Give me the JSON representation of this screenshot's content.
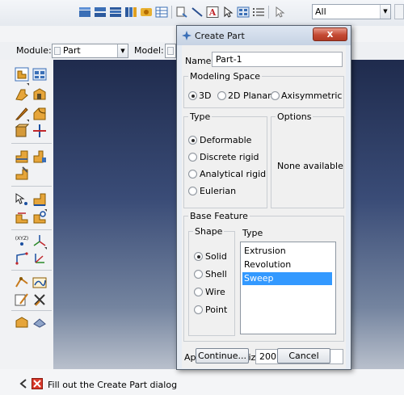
{
  "toolbar": {
    "filter_value": "All",
    "icons": [
      "view-cube-icon",
      "view-front-icon",
      "view-top-icon",
      "view-side-icon",
      "render-style-icon",
      "table-icon",
      "query-icon",
      "line-tool-icon",
      "text-annotation-icon",
      "select-cursor-icon",
      "grid-table-icon",
      "list-options-icon",
      "selection-arrow-icon"
    ]
  },
  "context": {
    "module_label": "Module:",
    "module_value": "Part",
    "model_label": "Model:"
  },
  "dialog": {
    "title": "Create Part",
    "close_glyph": "x",
    "name_label": "Name:",
    "name_value": "Part-1",
    "modeling_space": {
      "label": "Modeling Space",
      "options": [
        {
          "label": "3D",
          "checked": true
        },
        {
          "label": "2D Planar",
          "checked": false
        },
        {
          "label": "Axisymmetric",
          "checked": false
        }
      ]
    },
    "type": {
      "label": "Type",
      "options": [
        {
          "label": "Deformable",
          "checked": true
        },
        {
          "label": "Discrete rigid",
          "checked": false
        },
        {
          "label": "Analytical rigid",
          "checked": false
        },
        {
          "label": "Eulerian",
          "checked": false
        }
      ]
    },
    "options": {
      "label": "Options",
      "text": "None available"
    },
    "base_feature": {
      "label": "Base Feature",
      "shape": {
        "label": "Shape",
        "options": [
          {
            "label": "Solid",
            "checked": true
          },
          {
            "label": "Shell",
            "checked": false
          },
          {
            "label": "Wire",
            "checked": false
          },
          {
            "label": "Point",
            "checked": false
          }
        ]
      },
      "type": {
        "label": "Type",
        "items": [
          {
            "label": "Extrusion",
            "selected": false
          },
          {
            "label": "Revolution",
            "selected": false
          },
          {
            "label": "Sweep",
            "selected": true
          }
        ]
      }
    },
    "approx_size_label": "Approximate size:",
    "approx_size_value": "200",
    "continue_label": "Continue...",
    "cancel_label": "Cancel"
  },
  "status": {
    "message": "Fill out the Create Part dialog"
  },
  "colors": {
    "selection": "#3399ff",
    "close_button": "#c44a33",
    "viewport_top": "#1f2b4d",
    "viewport_bottom": "#b9c0cc"
  }
}
